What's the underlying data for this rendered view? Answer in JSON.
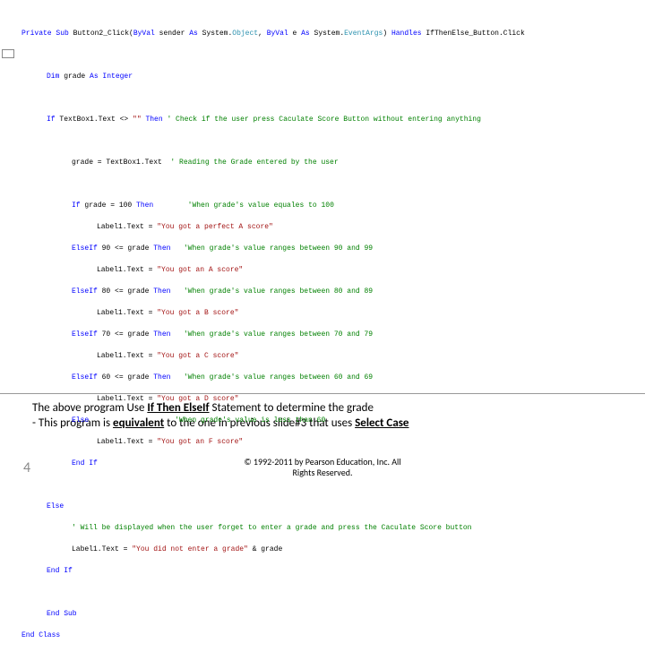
{
  "code": {
    "l1a": "Private Sub",
    "l1b": " Button2_Click(",
    "l1c": "ByVal",
    "l1d": " sender ",
    "l1e": "As",
    "l1f": " System.",
    "l1g": "Object",
    "l1h": ", ",
    "l1i": "ByVal",
    "l1j": " e ",
    "l1k": "As",
    "l1l": " System.",
    "l1m": "EventArgs",
    "l1n": ") ",
    "l1o": "Handles",
    "l1p": " IfThenElse_Button.Click",
    "l2a": "Dim",
    "l2b": " grade ",
    "l2c": "As Integer",
    "l3a": "If",
    "l3b": " TextBox1.Text <> ",
    "l3c": "\"\"",
    "l3d": " Then ",
    "l3e": "' Check if the user press Caculate Score Button without entering anything",
    "l4a": "grade = TextBox1.Text  ",
    "l4b": "' Reading the Grade entered by the user",
    "l5a": "If",
    "l5b": " grade = 100 ",
    "l5c": "Then",
    "l5d": "        ",
    "l5e": "'When grade's value equales to 100",
    "l6a": "Label1.Text = ",
    "l6b": "\"You got a perfect A score\"",
    "l7a": "ElseIf",
    "l7b": " 90 <= grade ",
    "l7c": "Then",
    "l7d": "   ",
    "l7e": "'When grade's value ranges between 90 and 99",
    "l8a": "Label1.Text = ",
    "l8b": "\"You got an A score\"",
    "l9a": "ElseIf",
    "l9b": " 80 <= grade ",
    "l9c": "Then",
    "l9d": "   ",
    "l9e": "'When grade's value ranges between 80 and 89",
    "l10a": "Label1.Text = ",
    "l10b": "\"You got a B score\"",
    "l11a": "ElseIf",
    "l11b": " 70 <= grade ",
    "l11c": "Then",
    "l11d": "   ",
    "l11e": "'When grade's value ranges between 70 and 79",
    "l12a": "Label1.Text = ",
    "l12b": "\"You got a C score\"",
    "l13a": "ElseIf",
    "l13b": " 60 <= grade ",
    "l13c": "Then",
    "l13d": "   ",
    "l13e": "'When grade's value ranges between 60 and 69",
    "l14a": "Label1.Text = ",
    "l14b": "\"You got a D score\"",
    "l15a": "Else",
    "l15b": "                    ",
    "l15e": "'When grade's value is less than 60",
    "l16a": "Label1.Text = ",
    "l16b": "\"You got an F score\"",
    "l17a": "End If",
    "l18a": "Else",
    "l19a": "' Will be displayed when the user forget to enter a grade and press the Caculate Score button",
    "l20a": "Label1.Text = ",
    "l20b": "\"You did not enter a grade\"",
    "l20c": " & grade",
    "l21a": "End If",
    "l22a": "End Sub",
    "l23a": "End Class"
  },
  "caption": {
    "line1_a": "The above program Use ",
    "line1_b": "If Then ElseIf",
    "line1_c": " Statement to determine the grade",
    "line2_a": "- This program is ",
    "line2_b": "equivalent",
    "line2_c": " to the one in previous slide#3 that uses ",
    "line2_d": "Select Case"
  },
  "footer": {
    "page": "4",
    "copy1": "© 1992-2011 by Pearson Education, Inc. All",
    "copy2": "Rights Reserved."
  }
}
